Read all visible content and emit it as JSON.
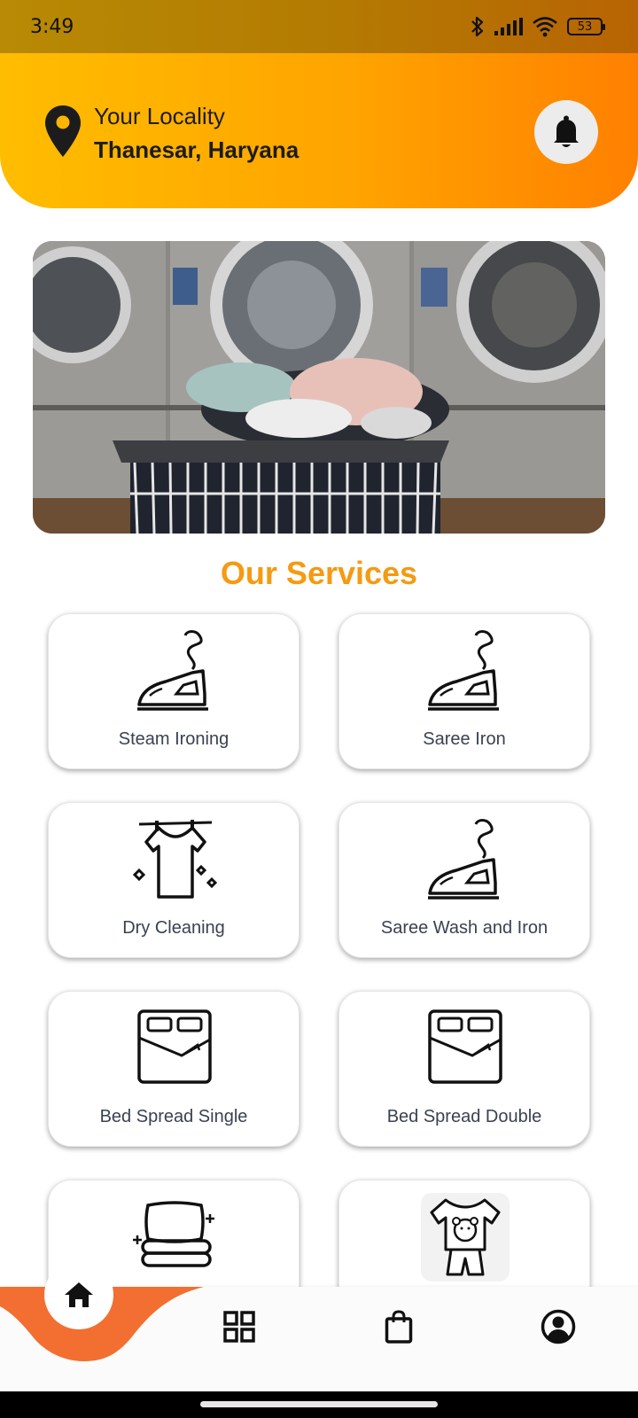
{
  "status_bar": {
    "time": "3:49",
    "battery": "53"
  },
  "header": {
    "locality_label": "Your Locality",
    "locality_value": "Thanesar, Haryana",
    "colors": {
      "gradient_start": "#ffbd00",
      "gradient_end": "#ff8000"
    }
  },
  "banner": {
    "image": "laundry-basket-in-front-of-washing-machines"
  },
  "services_title": "Our Services",
  "services": [
    {
      "label": "Steam Ironing",
      "icon": "iron-icon"
    },
    {
      "label": "Saree Iron",
      "icon": "iron-icon"
    },
    {
      "label": "Dry Cleaning",
      "icon": "tshirt-on-line-icon"
    },
    {
      "label": "Saree Wash and Iron",
      "icon": "iron-icon"
    },
    {
      "label": "Bed Spread Single",
      "icon": "bed-icon"
    },
    {
      "label": "Bed Spread Double",
      "icon": "bed-icon"
    },
    {
      "label": "",
      "icon": "pillow-blanket-icon"
    },
    {
      "label": "",
      "icon": "kids-clothes-icon"
    }
  ],
  "bottom_nav": {
    "items": [
      "home-icon",
      "grid-icon",
      "bag-icon",
      "profile-icon"
    ],
    "active": "home-icon",
    "accent": "#f26f31"
  }
}
